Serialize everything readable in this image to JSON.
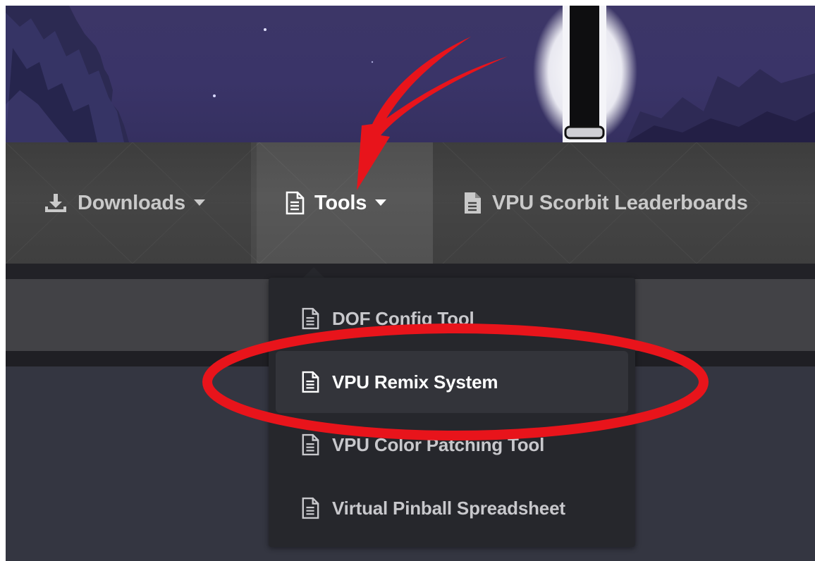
{
  "nav": {
    "items": [
      {
        "label": "Downloads",
        "icon": "download-icon",
        "has_caret": true
      },
      {
        "label": "Tools",
        "icon": "document-icon",
        "has_caret": true,
        "active": true
      },
      {
        "label": "VPU Scorbit Leaderboards",
        "icon": "document-icon",
        "has_caret": false
      }
    ]
  },
  "tools_menu": {
    "items": [
      {
        "label": "DOF Config Tool",
        "icon": "document-icon"
      },
      {
        "label": "VPU Remix System",
        "icon": "document-icon",
        "highlighted": true
      },
      {
        "label": "VPU Color Patching Tool",
        "icon": "document-icon"
      },
      {
        "label": "Virtual Pinball Spreadsheet",
        "icon": "document-icon"
      }
    ]
  },
  "annotations": {
    "arrow_color": "#e8141b",
    "circle_color": "#e8141b"
  },
  "colors": {
    "nav_bg": "#424242",
    "dropdown_bg": "#26272c",
    "page_bg": "#343641",
    "hero_bg": "#3a3468"
  }
}
